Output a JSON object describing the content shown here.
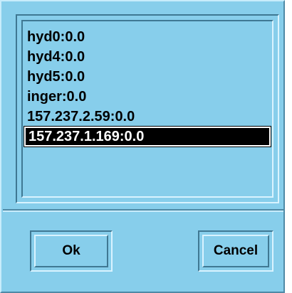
{
  "display_list": {
    "items": [
      {
        "label": "hyd0:0.0",
        "selected": false
      },
      {
        "label": "hyd4:0.0",
        "selected": false
      },
      {
        "label": "hyd5:0.0",
        "selected": false
      },
      {
        "label": "inger:0.0",
        "selected": false
      },
      {
        "label": "157.237.2.59:0.0",
        "selected": false
      },
      {
        "label": "157.237.1.169:0.0",
        "selected": true
      }
    ]
  },
  "buttons": {
    "ok_label": "Ok",
    "cancel_label": "Cancel"
  },
  "colors": {
    "background": "#87ceeb",
    "selection_bg": "#000000",
    "selection_text": "#ffffff"
  }
}
